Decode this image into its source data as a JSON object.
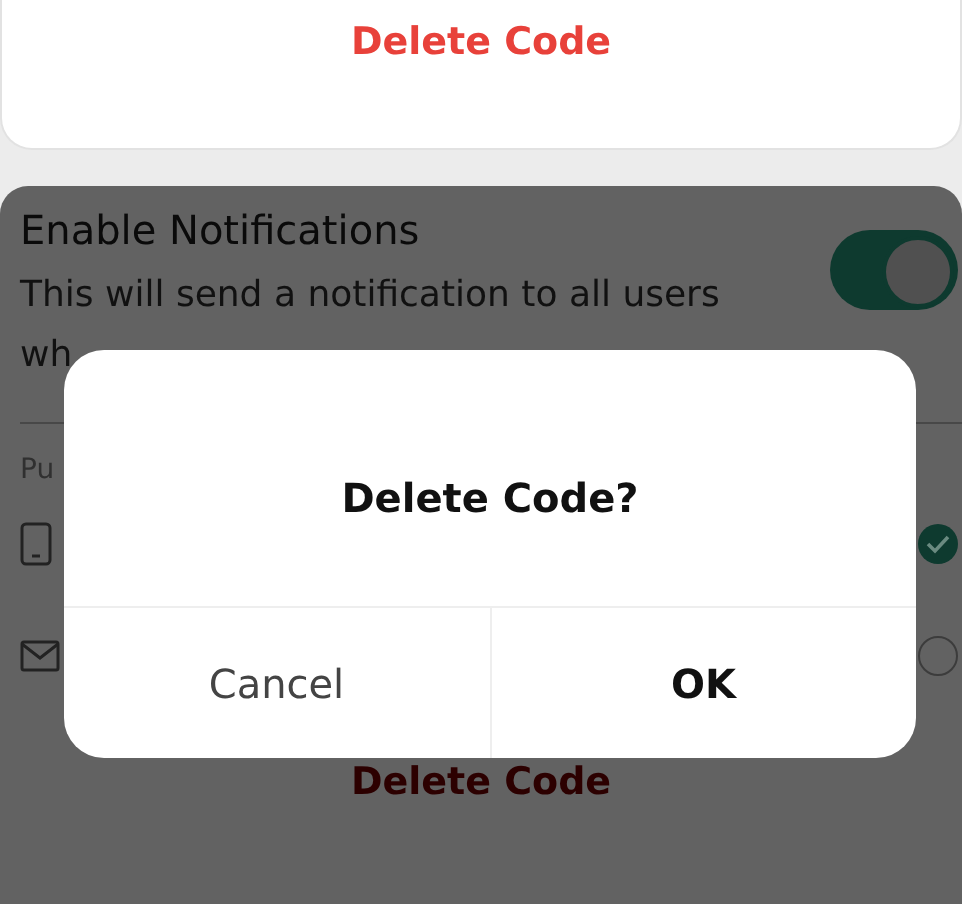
{
  "top_card": {
    "delete_button": "Delete Code"
  },
  "settings": {
    "title": "Enable Notifications",
    "description": "This will send a notification to all users",
    "description_cont": "wh",
    "notifications_on": true,
    "section_label": "Pu",
    "channels": [
      {
        "kind": "phone",
        "selected": true
      },
      {
        "kind": "mail",
        "selected": false
      }
    ],
    "delete_button": "Delete Code"
  },
  "dialog": {
    "title": "Delete Code?",
    "buttons": [
      {
        "label": "Cancel",
        "primary": false
      },
      {
        "label": "OK",
        "primary": true
      }
    ]
  }
}
